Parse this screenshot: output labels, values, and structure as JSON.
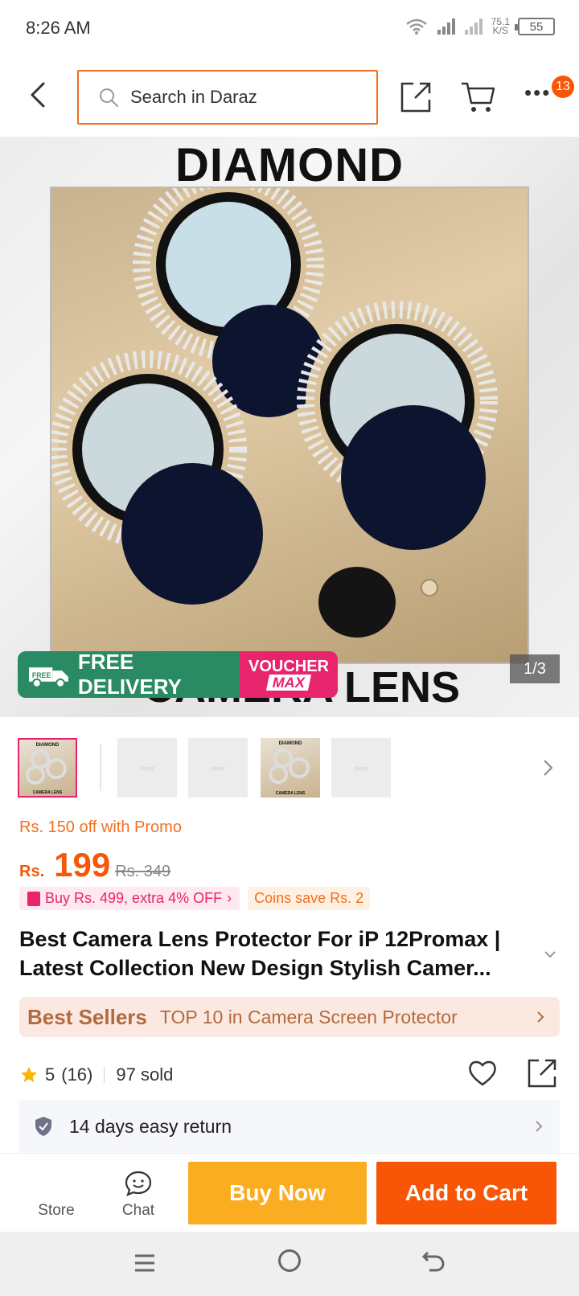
{
  "status_bar": {
    "time": "8:26 AM",
    "net_speed_value": "75.1",
    "net_speed_unit": "K/S",
    "battery": "55"
  },
  "header": {
    "search_placeholder": "Search in Daraz",
    "cart_badge_count": "13",
    "icons": [
      "back-arrow-icon",
      "search-icon",
      "share-icon",
      "cart-icon",
      "more-icon"
    ]
  },
  "hero": {
    "title": "DIAMOND",
    "bottom_text": "CAMERA LENS",
    "promo_free_tag": "FREE",
    "promo_free_delivery": "FREE DELIVERY",
    "promo_voucher": "VOUCHER",
    "promo_voucher_max": "MAX",
    "image_counter": "1/3"
  },
  "thumbnails": {
    "items": [
      "thumb-1",
      "thumb-2",
      "thumb-3",
      "thumb-4",
      "thumb-5"
    ],
    "active_index": 0,
    "thumb_caption_top": "DIAMOND",
    "thumb_caption_bottom": "CAMERA LENS",
    "placeholder_text": "daraz"
  },
  "pricing": {
    "promo_text": "Rs. 150 off with Promo",
    "currency": "Rs.",
    "price": "199",
    "original_price": "Rs. 349",
    "tag_buy": "Buy Rs. 499, extra 4% OFF",
    "tag_coins": "Coins save Rs. 2"
  },
  "product": {
    "title": "Best Camera Lens Protector For iP 12Promax | Latest Collection New Design Stylish Camer..."
  },
  "bestseller": {
    "label": "Best Sellers",
    "text": "TOP 10 in Camera Screen Protector"
  },
  "rating": {
    "score": "5",
    "reviews": "(16)",
    "sold": "97 sold"
  },
  "return_policy": {
    "text": "14 days easy return"
  },
  "action_bar": {
    "store_label": "Store",
    "chat_label": "Chat",
    "buy_now_label": "Buy Now",
    "add_to_cart_label": "Add to Cart"
  },
  "colors": {
    "brand_orange": "#f85606",
    "buy_now_yellow": "#fbad22",
    "search_border": "#f36f21",
    "voucher_pink": "#e8246d",
    "delivery_green": "#2a8a63"
  }
}
